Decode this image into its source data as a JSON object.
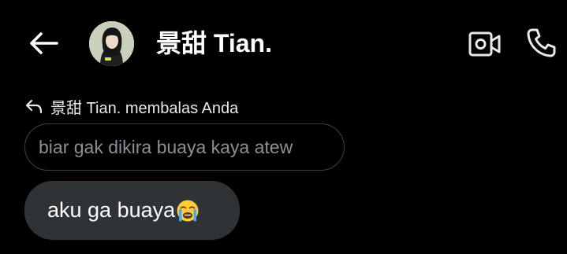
{
  "header": {
    "back_icon": "arrow-left-icon",
    "contact_name": "景甜 Tian.",
    "avatar_icon": "profile-photo",
    "video_icon": "video-camera-icon",
    "call_icon": "phone-icon"
  },
  "conversation": {
    "reply_context": {
      "icon": "reply-arrow-icon",
      "text": "景甜 Tian. membalas Anda"
    },
    "quoted_message": "biar gak dikira buaya kaya atew",
    "message": {
      "text": "aku ga buaya",
      "emoji_icon": "loudly-crying-face-emoji"
    }
  },
  "colors": {
    "background": "#000000",
    "bubble": "#2f3336",
    "quoted_border": "#3e4144",
    "quoted_text": "#8b9096",
    "text": "#ffffff"
  }
}
